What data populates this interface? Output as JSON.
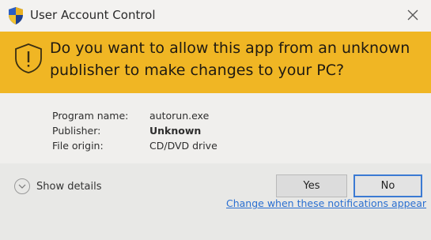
{
  "window": {
    "title": "User Account Control",
    "shield_icon": "uac-shield-icon",
    "close_icon": "close-icon"
  },
  "banner": {
    "question": "Do you want to allow this app from an unknown publisher to make changes to your PC?",
    "icon": "warning-shield-icon",
    "color": "#f0b624"
  },
  "details": {
    "program_name_label": "Program name:",
    "program_name_value": "autorun.exe",
    "publisher_label": "Publisher:",
    "publisher_value": "Unknown",
    "file_origin_label": "File origin:",
    "file_origin_value": "CD/DVD drive"
  },
  "footer": {
    "show_details_label": "Show details",
    "show_details_icon": "chevron-down-icon",
    "yes_label": "Yes",
    "no_label": "No",
    "notifications_link": "Change when these notifications appear",
    "link_color": "#2a6fd1"
  }
}
